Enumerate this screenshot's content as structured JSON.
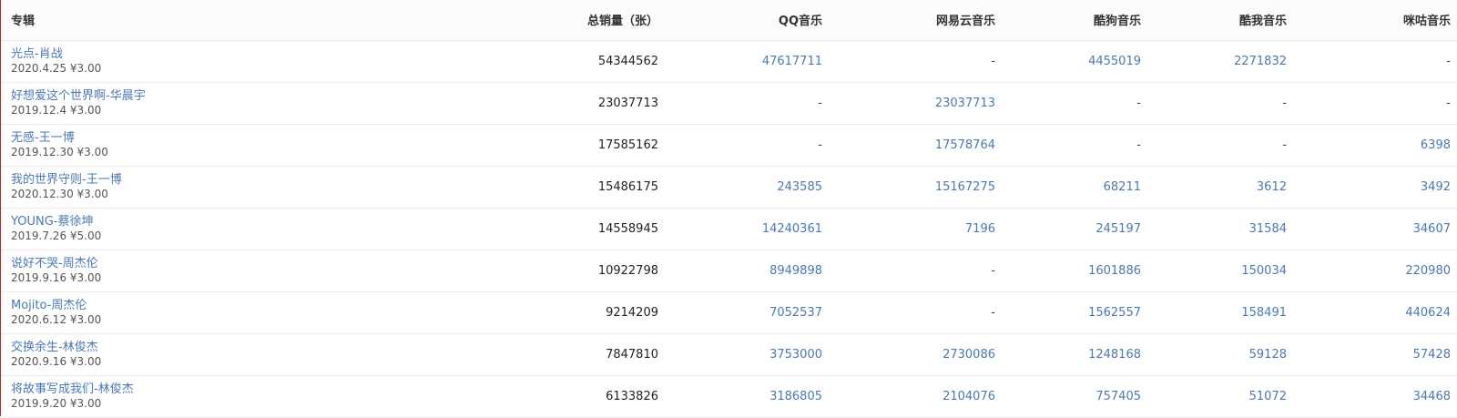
{
  "headers": {
    "album": "专辑",
    "total": "总销量（张）",
    "qq": "QQ音乐",
    "netease": "网易云音乐",
    "kugou": "酷狗音乐",
    "kuwo": "酷我音乐",
    "migu": "咪咕音乐"
  },
  "rows": [
    {
      "title": "光点-肖战",
      "meta": "2020.4.25 ¥3.00",
      "total": "54344562",
      "qq": "47617711",
      "netease": "-",
      "kugou": "4455019",
      "kuwo": "2271832",
      "migu": "-"
    },
    {
      "title": "好想爱这个世界啊-华晨宇",
      "meta": "2019.12.4 ¥3.00",
      "total": "23037713",
      "qq": "-",
      "netease": "23037713",
      "kugou": "-",
      "kuwo": "-",
      "migu": "-"
    },
    {
      "title": "无感-王一博",
      "meta": "2019.12.30 ¥3.00",
      "total": "17585162",
      "qq": "-",
      "netease": "17578764",
      "kugou": "-",
      "kuwo": "-",
      "migu": "6398"
    },
    {
      "title": "我的世界守则-王一博",
      "meta": "2020.12.30 ¥3.00",
      "total": "15486175",
      "qq": "243585",
      "netease": "15167275",
      "kugou": "68211",
      "kuwo": "3612",
      "migu": "3492"
    },
    {
      "title": "YOUNG-蔡徐坤",
      "meta": "2019.7.26 ¥5.00",
      "total": "14558945",
      "qq": "14240361",
      "netease": "7196",
      "kugou": "245197",
      "kuwo": "31584",
      "migu": "34607"
    },
    {
      "title": "说好不哭-周杰伦",
      "meta": "2019.9.16 ¥3.00",
      "total": "10922798",
      "qq": "8949898",
      "netease": "-",
      "kugou": "1601886",
      "kuwo": "150034",
      "migu": "220980"
    },
    {
      "title": "Mojito-周杰伦",
      "meta": "2020.6.12 ¥3.00",
      "total": "9214209",
      "qq": "7052537",
      "netease": "-",
      "kugou": "1562557",
      "kuwo": "158491",
      "migu": "440624"
    },
    {
      "title": "交换余生-林俊杰",
      "meta": "2020.9.16 ¥3.00",
      "total": "7847810",
      "qq": "3753000",
      "netease": "2730086",
      "kugou": "1248168",
      "kuwo": "59128",
      "migu": "57428"
    },
    {
      "title": "将故事写成我们-林俊杰",
      "meta": "2019.9.20 ¥3.00",
      "total": "6133826",
      "qq": "3186805",
      "netease": "2104076",
      "kugou": "757405",
      "kuwo": "51072",
      "migu": "34468"
    }
  ]
}
